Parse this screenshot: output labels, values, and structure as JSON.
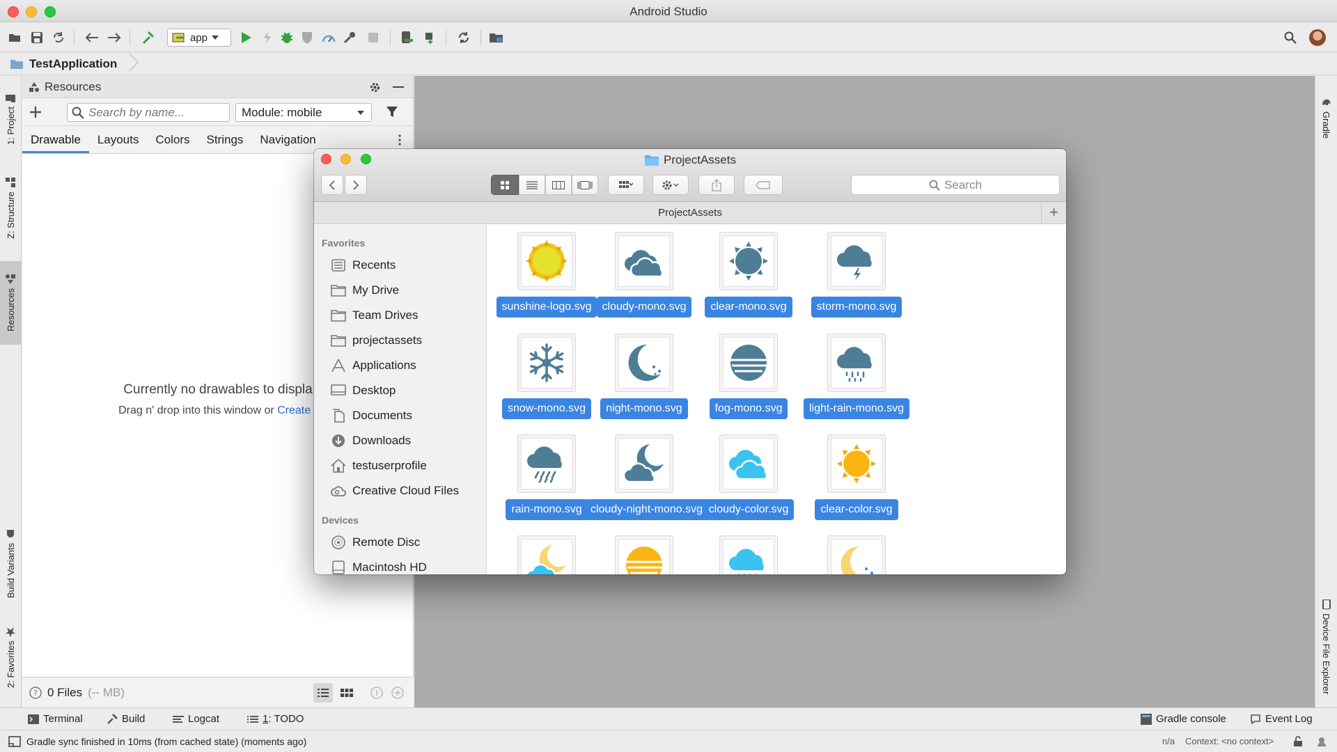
{
  "window": {
    "title": "Android Studio"
  },
  "toolbar": {
    "run_config": "app"
  },
  "breadcrumb": {
    "project": "TestApplication"
  },
  "left_tabs": [
    {
      "label": "1: Project"
    },
    {
      "label": "Z: Structure"
    },
    {
      "label": "Resources"
    },
    {
      "label": "Build Variants"
    },
    {
      "label": "2: Favorites"
    }
  ],
  "right_tabs": [
    {
      "label": "Gradle"
    },
    {
      "label": "Device File Explorer"
    }
  ],
  "resources": {
    "title": "Resources",
    "search_placeholder": "Search by name...",
    "module": "Module: mobile",
    "tabs": [
      "Drawable",
      "Layouts",
      "Colors",
      "Strings",
      "Navigation"
    ],
    "empty_main": "Currently no drawables to displa",
    "empty_sub_prefix": "Drag n' drop into this window or ",
    "empty_sub_link": "Create r",
    "footer_count": "0 Files",
    "footer_size": "(-- MB)"
  },
  "bottom_tools": {
    "terminal": "Terminal",
    "build": "Build",
    "logcat": "Logcat",
    "todo_prefix": "1",
    "todo": ": TODO",
    "gradle_console": "Gradle console",
    "event_log": "Event Log"
  },
  "status": {
    "message": "Gradle sync finished in 10ms (from cached state) (moments ago)",
    "position": "n/a",
    "context": "Context: <no context>"
  },
  "finder": {
    "title": "ProjectAssets",
    "path": "ProjectAssets",
    "search_placeholder": "Search",
    "favorites_header": "Favorites",
    "favorites": [
      {
        "label": "Recents",
        "icon": "recents-icon"
      },
      {
        "label": "My Drive",
        "icon": "folder-icon"
      },
      {
        "label": "Team Drives",
        "icon": "folder-icon"
      },
      {
        "label": "projectassets",
        "icon": "folder-icon"
      },
      {
        "label": "Applications",
        "icon": "applications-icon"
      },
      {
        "label": "Desktop",
        "icon": "desktop-icon"
      },
      {
        "label": "Documents",
        "icon": "documents-icon"
      },
      {
        "label": "Downloads",
        "icon": "downloads-icon"
      },
      {
        "label": "testuserprofile",
        "icon": "home-icon"
      },
      {
        "label": "Creative Cloud Files",
        "icon": "creative-cloud-icon"
      }
    ],
    "devices_header": "Devices",
    "devices": [
      {
        "label": "Remote Disc",
        "icon": "disc-icon"
      },
      {
        "label": "Macintosh HD",
        "icon": "hard-drive-icon"
      }
    ],
    "files": [
      {
        "name": "sunshine-logo.svg",
        "icon": "sun-color"
      },
      {
        "name": "cloudy-mono.svg",
        "icon": "cloud-mono"
      },
      {
        "name": "clear-mono.svg",
        "icon": "sun-mono"
      },
      {
        "name": "storm-mono.svg",
        "icon": "storm-mono"
      },
      {
        "name": "snow-mono.svg",
        "icon": "snow-mono"
      },
      {
        "name": "night-mono.svg",
        "icon": "moon-mono"
      },
      {
        "name": "fog-mono.svg",
        "icon": "fog-mono"
      },
      {
        "name": "light-rain-mono.svg",
        "icon": "light-rain-mono"
      },
      {
        "name": "rain-mono.svg",
        "icon": "rain-mono"
      },
      {
        "name": "cloudy-night-mono.svg",
        "icon": "cloudy-night-mono"
      },
      {
        "name": "cloudy-color.svg",
        "icon": "cloud-color"
      },
      {
        "name": "clear-color.svg",
        "icon": "sun-orange"
      },
      {
        "name": "",
        "icon": "cloudy-night-color"
      },
      {
        "name": "",
        "icon": "fog-color"
      },
      {
        "name": "",
        "icon": "rain-color"
      },
      {
        "name": "",
        "icon": "moon-color"
      }
    ]
  },
  "colors": {
    "accent": "#3a84e2",
    "mono_icon": "#4e7d96",
    "sun_yellow": "#f0d316",
    "sun_orange": "#fbb512",
    "sky_blue": "#3ac2f0",
    "run_green": "#36a33a"
  }
}
